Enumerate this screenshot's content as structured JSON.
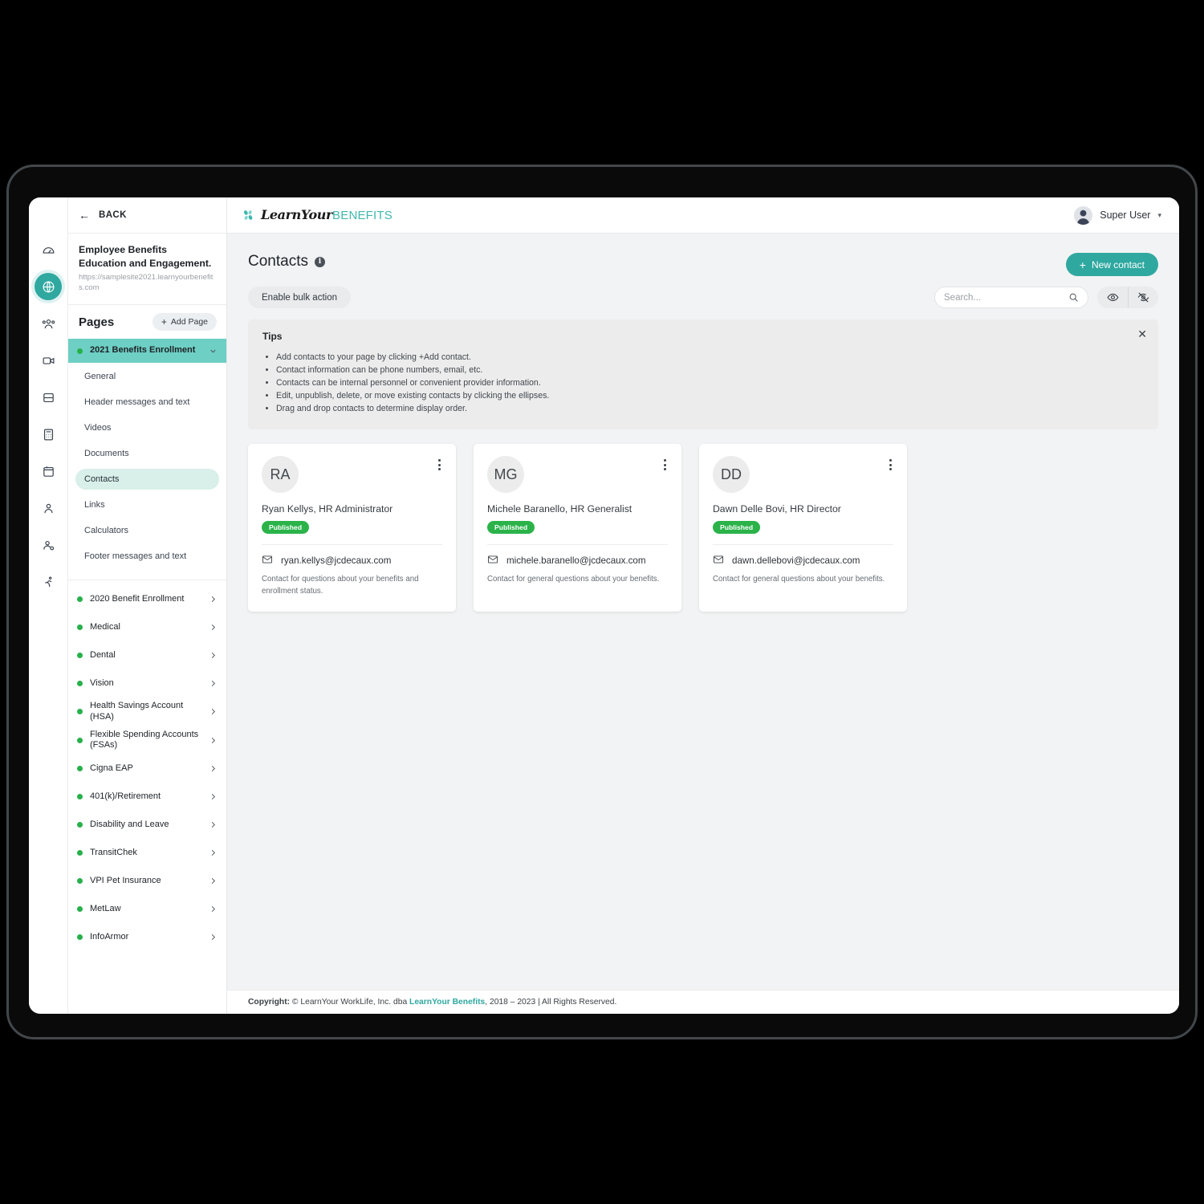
{
  "rail": {
    "items": [
      {
        "name": "dashboard-icon",
        "active": false
      },
      {
        "name": "globe-icon",
        "active": true
      },
      {
        "name": "people-group-icon",
        "active": false
      },
      {
        "name": "video-icon",
        "active": false
      },
      {
        "name": "layout-icon",
        "active": false
      },
      {
        "name": "calculator-icon",
        "active": false
      },
      {
        "name": "calendar-icon",
        "active": false
      },
      {
        "name": "person-icon",
        "active": false
      },
      {
        "name": "person-settings-icon",
        "active": false
      },
      {
        "name": "activity-icon",
        "active": false
      }
    ]
  },
  "sidebar": {
    "back_label": "BACK",
    "site_title": "Employee Benefits Education and Engagement.",
    "site_url": "https://samplesite2021.learnyourbenefits.com",
    "pages_title": "Pages",
    "add_page_label": "Add Page",
    "active_group": "2021 Benefits Enrollment",
    "sub_items": [
      "General",
      "Header messages and text",
      "Videos",
      "Documents",
      "Contacts",
      "Links",
      "Calculators",
      "Footer messages and text"
    ],
    "active_sub_item": "Contacts",
    "groups": [
      "2020 Benefit Enrollment",
      "Medical",
      "Dental",
      "Vision",
      "Health Savings Account (HSA)",
      "Flexible Spending Accounts (FSAs)",
      "Cigna EAP",
      "401(k)/Retirement",
      "Disability and Leave",
      "TransitChek",
      "VPI Pet Insurance",
      "MetLaw",
      "InfoArmor"
    ]
  },
  "topbar": {
    "logo_script": "LearnYour",
    "logo_word": "BENEFITS",
    "user_name": "Super User",
    "caret": "▾"
  },
  "page": {
    "title": "Contacts",
    "info_glyph": "i",
    "new_contact_label": "New contact",
    "bulk_action_label": "Enable bulk action"
  },
  "search": {
    "placeholder": "Search...",
    "value": ""
  },
  "tips": {
    "title": "Tips",
    "close_glyph": "✕",
    "items": [
      "Add contacts to your page by clicking +Add contact.",
      "Contact information can be phone numbers, email, etc.",
      "Contacts can be internal personnel or convenient provider information.",
      "Edit, unpublish, delete, or move existing contacts by clicking the ellipses.",
      "Drag and drop contacts to determine display order."
    ]
  },
  "contacts": [
    {
      "initials": "RA",
      "name": "Ryan Kellys, HR Administrator",
      "status": "Published",
      "email": "ryan.kellys@jcdecaux.com",
      "note": "Contact for questions about your benefits and enrollment status."
    },
    {
      "initials": "MG",
      "name": "Michele Baranello, HR Generalist",
      "status": "Published",
      "email": "michele.baranello@jcdecaux.com",
      "note": "Contact for general questions about your benefits."
    },
    {
      "initials": "DD",
      "name": "Dawn Delle Bovi, HR Director",
      "status": "Published",
      "email": "dawn.dellebovi@jcdecaux.com",
      "note": "Contact for general questions about your benefits."
    }
  ],
  "footer": {
    "label": "Copyright:",
    "text_before": " © LearnYour WorkLife, Inc. dba ",
    "link": "LearnYour Benefits",
    "text_after": ", 2018 – 2023 | All Rights Reserved."
  },
  "colors": {
    "accent_teal": "#2fa8a0",
    "active_row_teal": "#6ecfc4",
    "status_green": "#2bb34a",
    "page_bg": "#f2f3f4"
  }
}
